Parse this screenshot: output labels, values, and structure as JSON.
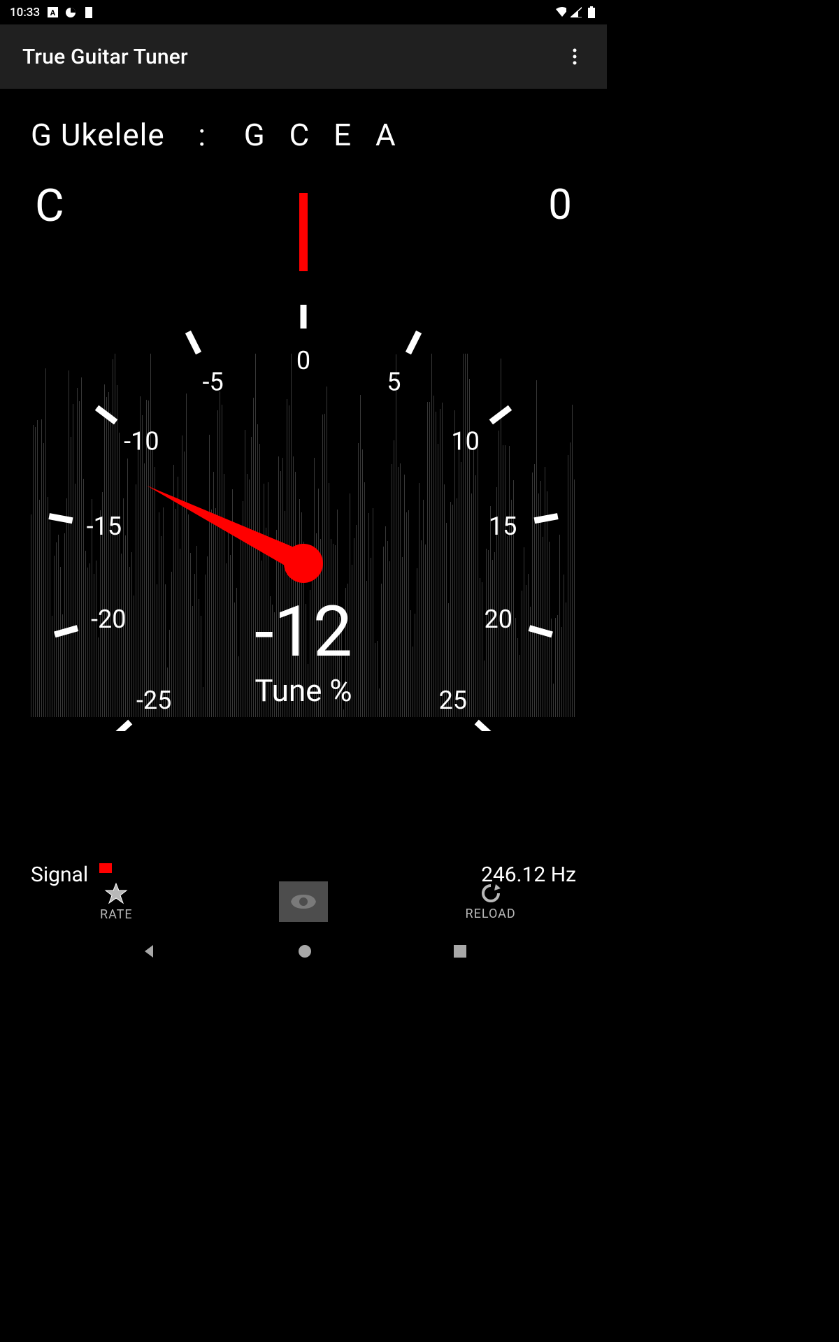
{
  "status": {
    "time": "10:33"
  },
  "app": {
    "title": "True Guitar Tuner"
  },
  "tuning": {
    "name": "G Ukelele",
    "separator": ":",
    "notes": "G  C  E  A"
  },
  "display": {
    "note": "C",
    "octave": "0"
  },
  "gauge": {
    "value": "-12",
    "unit": "Tune %",
    "ticks": [
      "-25",
      "-20",
      "-15",
      "-10",
      "-5",
      "0",
      "5",
      "10",
      "15",
      "20",
      "25"
    ]
  },
  "footer": {
    "signal_label": "Signal",
    "frequency": "246.12 Hz"
  },
  "actions": {
    "rate": "RATE",
    "reload": "RELOAD"
  }
}
